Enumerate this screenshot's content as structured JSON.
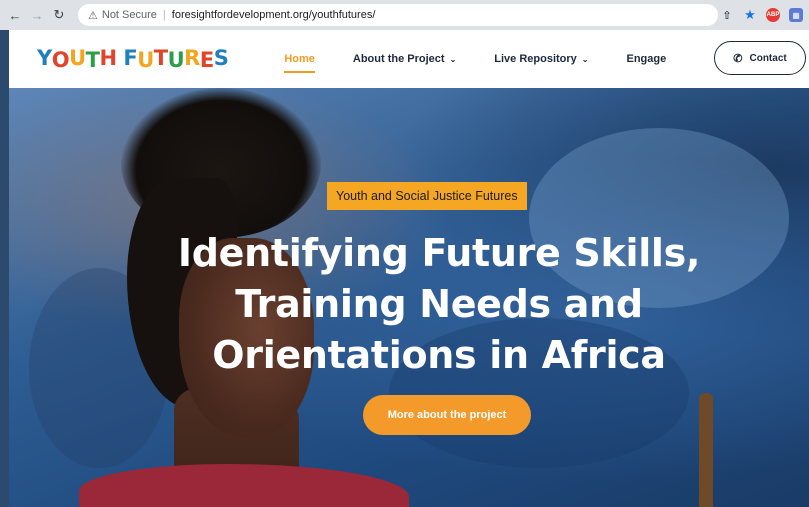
{
  "browser": {
    "security_label": "Not Secure",
    "url": "foresightfordevelopment.org/youthfutures/"
  },
  "site": {
    "logo_letters": [
      {
        "ch": "Y",
        "color": "#1f7fbf"
      },
      {
        "ch": "O",
        "color": "#e0452b"
      },
      {
        "ch": "U",
        "color": "#f2a51e"
      },
      {
        "ch": "T",
        "color": "#2b9e4a"
      },
      {
        "ch": "H",
        "color": "#e0452b"
      },
      {
        "ch": " ",
        "color": "#000000"
      },
      {
        "ch": "F",
        "color": "#1f7fbf"
      },
      {
        "ch": "U",
        "color": "#f2a51e"
      },
      {
        "ch": "T",
        "color": "#e0452b"
      },
      {
        "ch": "U",
        "color": "#2b9e4a"
      },
      {
        "ch": "R",
        "color": "#f2a51e"
      },
      {
        "ch": "E",
        "color": "#e0452b"
      },
      {
        "ch": "S",
        "color": "#1f7fbf"
      }
    ],
    "nav": {
      "home": "Home",
      "about": "About the Project",
      "repository": "Live Repository",
      "engage": "Engage"
    },
    "contact_label": "Contact",
    "accent_color": "#f29b21"
  },
  "hero": {
    "badge": "Youth and Social Justice Futures",
    "headline_line1": "Identifying Future Skills,",
    "headline_line2": "Training Needs and",
    "headline_line3": "Orientations in Africa",
    "cta_label": "More about the project"
  }
}
